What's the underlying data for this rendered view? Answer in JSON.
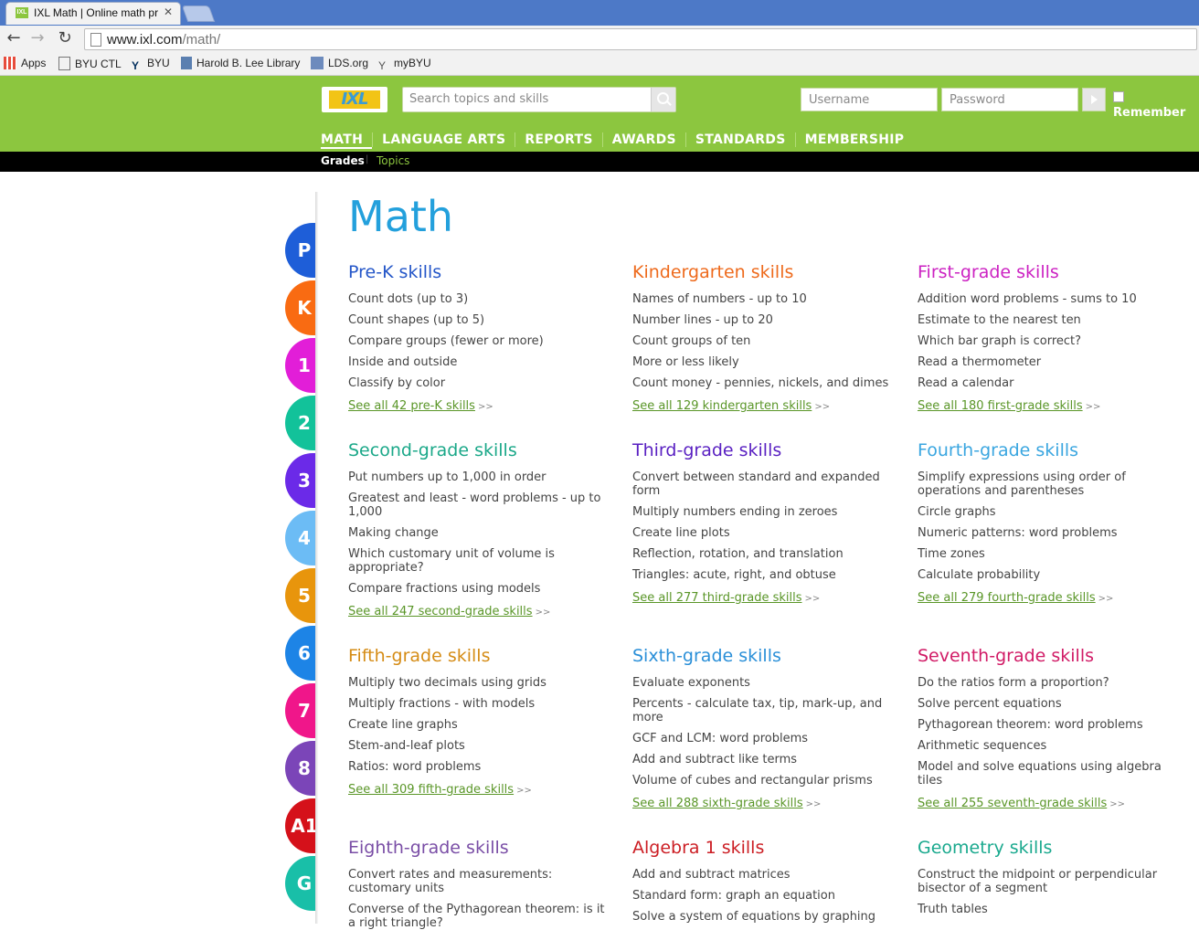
{
  "browser": {
    "tab_title": "IXL Math | Online math pr",
    "url_host": "www.ixl.com",
    "url_path": "/math/",
    "bookmarks": [
      "Apps",
      "BYU CTL",
      "BYU",
      "Harold B. Lee Library",
      "LDS.org",
      "myBYU"
    ]
  },
  "header": {
    "logo": "IXL",
    "search_placeholder": "Search topics and skills",
    "username_placeholder": "Username",
    "password_placeholder": "Password",
    "remember_label": "Remember",
    "nav": [
      "MATH",
      "LANGUAGE ARTS",
      "REPORTS",
      "AWARDS",
      "STANDARDS",
      "MEMBERSHIP"
    ],
    "subnav": {
      "grades": "Grades",
      "topics": "Topics"
    }
  },
  "grade_tabs": [
    {
      "label": "P",
      "color": "#1e5ed8"
    },
    {
      "label": "K",
      "color": "#f96b12"
    },
    {
      "label": "1",
      "color": "#e21ed8"
    },
    {
      "label": "2",
      "color": "#12c29a"
    },
    {
      "label": "3",
      "color": "#6b2ae8"
    },
    {
      "label": "4",
      "color": "#6cbcf5"
    },
    {
      "label": "5",
      "color": "#e8950c"
    },
    {
      "label": "6",
      "color": "#1d84e6"
    },
    {
      "label": "7",
      "color": "#f0168a"
    },
    {
      "label": "8",
      "color": "#7b45b8"
    },
    {
      "label": "A1",
      "color": "#d5111a"
    },
    {
      "label": "G",
      "color": "#19bfa8"
    }
  ],
  "page_title": "Math",
  "grades": [
    {
      "title": "Pre-K skills",
      "color": "#2456c8",
      "skills": [
        "Count dots (up to 3)",
        "Count shapes (up to 5)",
        "Compare groups (fewer or more)",
        "Inside and outside",
        "Classify by color"
      ],
      "see": "See all 42 pre-K skills"
    },
    {
      "title": "Kindergarten skills",
      "color": "#ee6a1c",
      "skills": [
        "Names of numbers - up to 10",
        "Number lines - up to 20",
        "Count groups of ten",
        "More or less likely",
        "Count money - pennies, nickels, and dimes"
      ],
      "see": "See all 129 kindergarten skills"
    },
    {
      "title": "First-grade skills",
      "color": "#cc22c2",
      "skills": [
        "Addition word problems - sums to 10",
        "Estimate to the nearest ten",
        "Which bar graph is correct?",
        "Read a thermometer",
        "Read a calendar"
      ],
      "see": "See all 180 first-grade skills"
    },
    {
      "title": "Second-grade skills",
      "color": "#1ba889",
      "skills": [
        "Put numbers up to 1,000 in order",
        "Greatest and least - word problems - up to 1,000",
        "Making change",
        "Which customary unit of volume is appropriate?",
        "Compare fractions using models"
      ],
      "see": "See all 247 second-grade skills"
    },
    {
      "title": "Third-grade skills",
      "color": "#5a21c2",
      "skills": [
        "Convert between standard and expanded form",
        "Multiply numbers ending in zeroes",
        "Create line plots",
        "Reflection, rotation, and translation",
        "Triangles: acute, right, and obtuse"
      ],
      "see": "See all 277 third-grade skills"
    },
    {
      "title": "Fourth-grade skills",
      "color": "#3aa6e0",
      "skills": [
        "Simplify expressions using order of operations and parentheses",
        "Circle graphs",
        "Numeric patterns: word problems",
        "Time zones",
        "Calculate probability"
      ],
      "see": "See all 279 fourth-grade skills"
    },
    {
      "title": "Fifth-grade skills",
      "color": "#d58c16",
      "skills": [
        "Multiply two decimals using grids",
        "Multiply fractions - with models",
        "Create line graphs",
        "Stem-and-leaf plots",
        "Ratios: word problems"
      ],
      "see": "See all 309 fifth-grade skills"
    },
    {
      "title": "Sixth-grade skills",
      "color": "#2a8fd8",
      "skills": [
        "Evaluate exponents",
        "Percents - calculate tax, tip, mark-up, and more",
        "GCF and LCM: word problems",
        "Add and subtract like terms",
        "Volume of cubes and rectangular prisms"
      ],
      "see": "See all 288 sixth-grade skills"
    },
    {
      "title": "Seventh-grade skills",
      "color": "#d11b66",
      "skills": [
        "Do the ratios form a proportion?",
        "Solve percent equations",
        "Pythagorean theorem: word problems",
        "Arithmetic sequences",
        "Model and solve equations using algebra tiles"
      ],
      "see": "See all 255 seventh-grade skills"
    },
    {
      "title": "Eighth-grade skills",
      "color": "#7a4ea6",
      "skills": [
        "Convert rates and measurements: customary units",
        "Converse of the Pythagorean theorem: is it a right triangle?"
      ],
      "see": ""
    },
    {
      "title": "Algebra 1 skills",
      "color": "#cc1e24",
      "skills": [
        "Add and subtract matrices",
        "Standard form: graph an equation",
        "Solve a system of equations by graphing"
      ],
      "see": ""
    },
    {
      "title": "Geometry skills",
      "color": "#1aa98e",
      "skills": [
        "Construct the midpoint or perpendicular bisector of a segment",
        "Truth tables"
      ],
      "see": ""
    }
  ]
}
